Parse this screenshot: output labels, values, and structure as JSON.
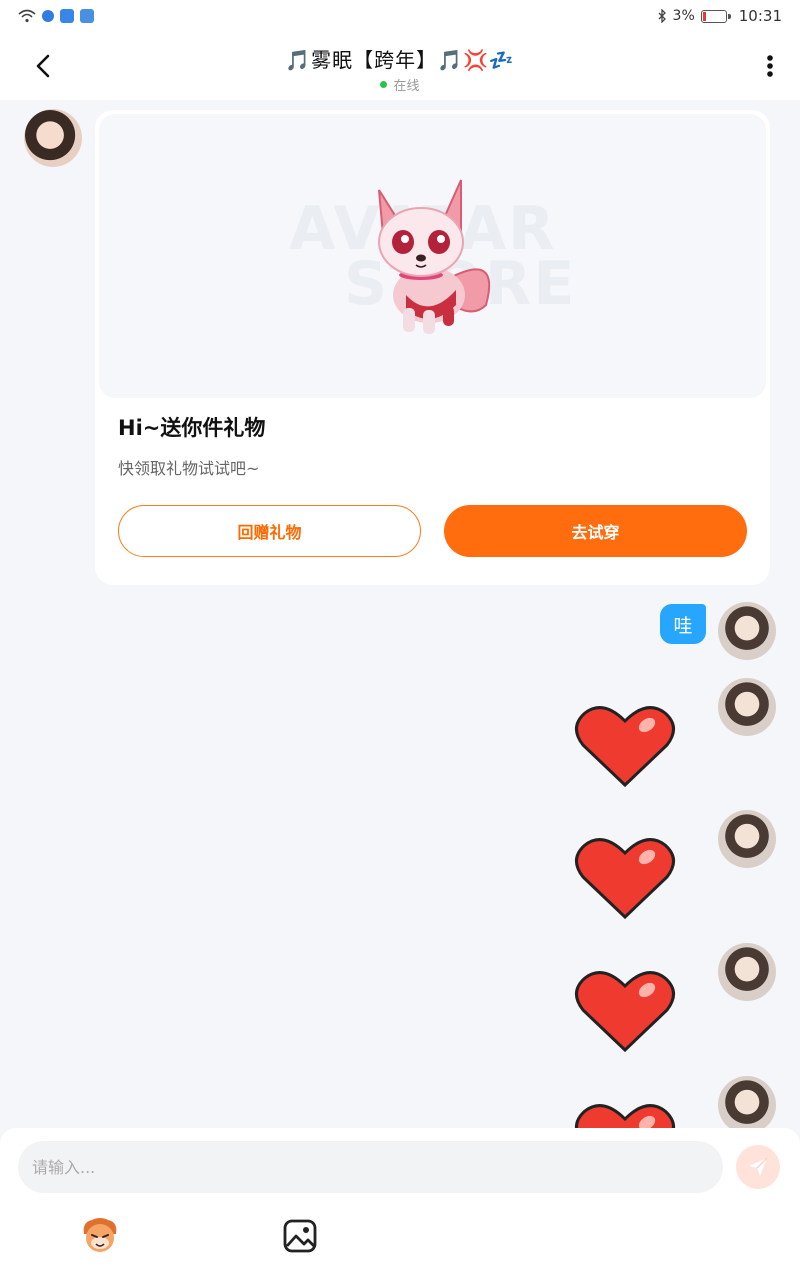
{
  "status_bar": {
    "battery": "3%",
    "time": "10:31"
  },
  "header": {
    "title": "🎵雾眠【跨年】🎵💢💤",
    "status": "在线"
  },
  "gift_card": {
    "title": "Hi~送你件礼物",
    "subtitle": "快领取礼物试试吧~",
    "watermark_top": "AVATAR",
    "watermark_bottom": "STORE",
    "return_button": "回赠礼物",
    "try_button": "去试穿"
  },
  "messages": [
    {
      "from": "me",
      "type": "text",
      "text": "哇"
    },
    {
      "from": "me",
      "type": "sticker",
      "sticker": "heart-sticker"
    },
    {
      "from": "me",
      "type": "sticker",
      "sticker": "heart-sticker"
    },
    {
      "from": "me",
      "type": "sticker",
      "sticker": "heart-sticker"
    },
    {
      "from": "me",
      "type": "sticker",
      "sticker": "heart-sticker"
    }
  ],
  "composer": {
    "placeholder": "请输入...",
    "tools": [
      "avatar-emoji-icon",
      "image-icon"
    ]
  },
  "colors": {
    "accent": "#ff6d0f",
    "bubble": "#26a6ff",
    "online": "#2bc24a",
    "background": "#f4f6f9"
  }
}
